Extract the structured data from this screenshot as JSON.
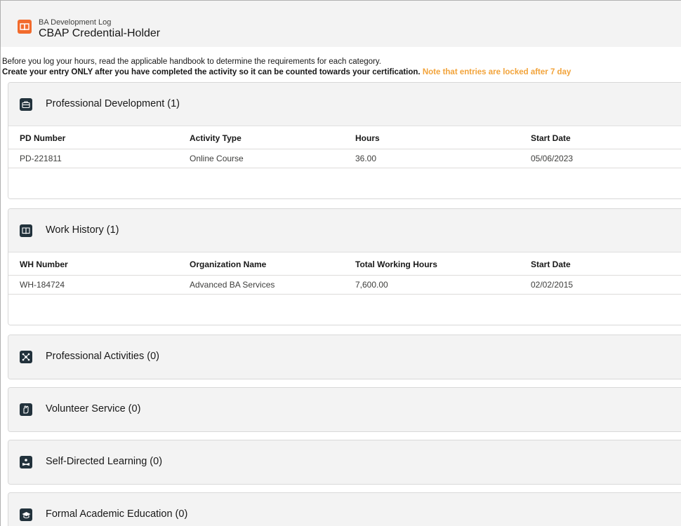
{
  "header": {
    "subtitle": "BA Development Log",
    "title": "CBAP Credential-Holder",
    "icon": "book-open-icon",
    "accent": "#f26b2c"
  },
  "intro": {
    "line1": "Before you log your hours, read the applicable handbook to determine the requirements for each category.",
    "line2": "Create your entry ONLY after you have completed the activity so it can be counted towards your certification.",
    "warning": "Note that entries are locked after 7 day",
    "warning_color": "#f2a33a"
  },
  "sections": {
    "pd": {
      "title": "Professional Development (1)",
      "icon": "briefcase-icon",
      "columns": [
        "PD Number",
        "Activity Type",
        "Hours",
        "Start Date"
      ],
      "rows": [
        [
          "PD-221811",
          "Online Course",
          "36.00",
          "05/06/2023"
        ]
      ]
    },
    "wh": {
      "title": "Work History (1)",
      "icon": "book-icon",
      "columns": [
        "WH Number",
        "Organization Name",
        "Total Working Hours",
        "Start Date"
      ],
      "rows": [
        [
          "WH-184724",
          "Advanced BA Services",
          "7,600.00",
          "02/02/2015"
        ]
      ]
    },
    "pa": {
      "title": "Professional Activities (0)",
      "icon": "network-icon"
    },
    "vs": {
      "title": "Volunteer Service (0)",
      "icon": "raised-hand-icon"
    },
    "sdl": {
      "title": "Self-Directed Learning (0)",
      "icon": "person-reading-icon"
    },
    "fae": {
      "title": "Formal Academic Education (0)",
      "icon": "graduation-cap-icon"
    }
  }
}
